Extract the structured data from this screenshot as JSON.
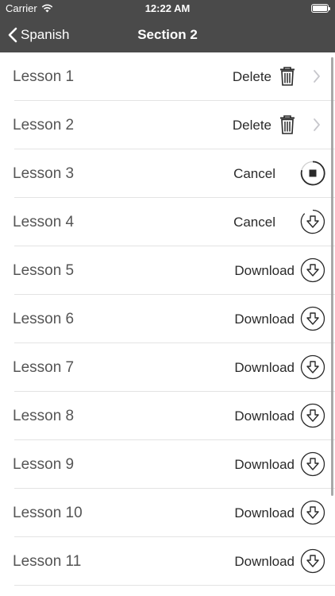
{
  "status_bar": {
    "carrier": "Carrier",
    "time": "12:22 AM"
  },
  "nav": {
    "back_label": "Spanish",
    "title": "Section 2"
  },
  "lessons": [
    {
      "label": "Lesson 1",
      "action": "Delete",
      "state": "downloaded"
    },
    {
      "label": "Lesson 2",
      "action": "Delete",
      "state": "downloaded"
    },
    {
      "label": "Lesson 3",
      "action": "Cancel",
      "state": "downloading"
    },
    {
      "label": "Lesson 4",
      "action": "Cancel",
      "state": "queued"
    },
    {
      "label": "Lesson 5",
      "action": "Download",
      "state": "available"
    },
    {
      "label": "Lesson 6",
      "action": "Download",
      "state": "available"
    },
    {
      "label": "Lesson 7",
      "action": "Download",
      "state": "available"
    },
    {
      "label": "Lesson 8",
      "action": "Download",
      "state": "available"
    },
    {
      "label": "Lesson 9",
      "action": "Download",
      "state": "available"
    },
    {
      "label": "Lesson 10",
      "action": "Download",
      "state": "available"
    },
    {
      "label": "Lesson 11",
      "action": "Download",
      "state": "available"
    }
  ],
  "colors": {
    "bar": "#4a4a4a",
    "text": "#555555",
    "icon": "#2a2a2a",
    "chevron": "#c7c7cc"
  }
}
